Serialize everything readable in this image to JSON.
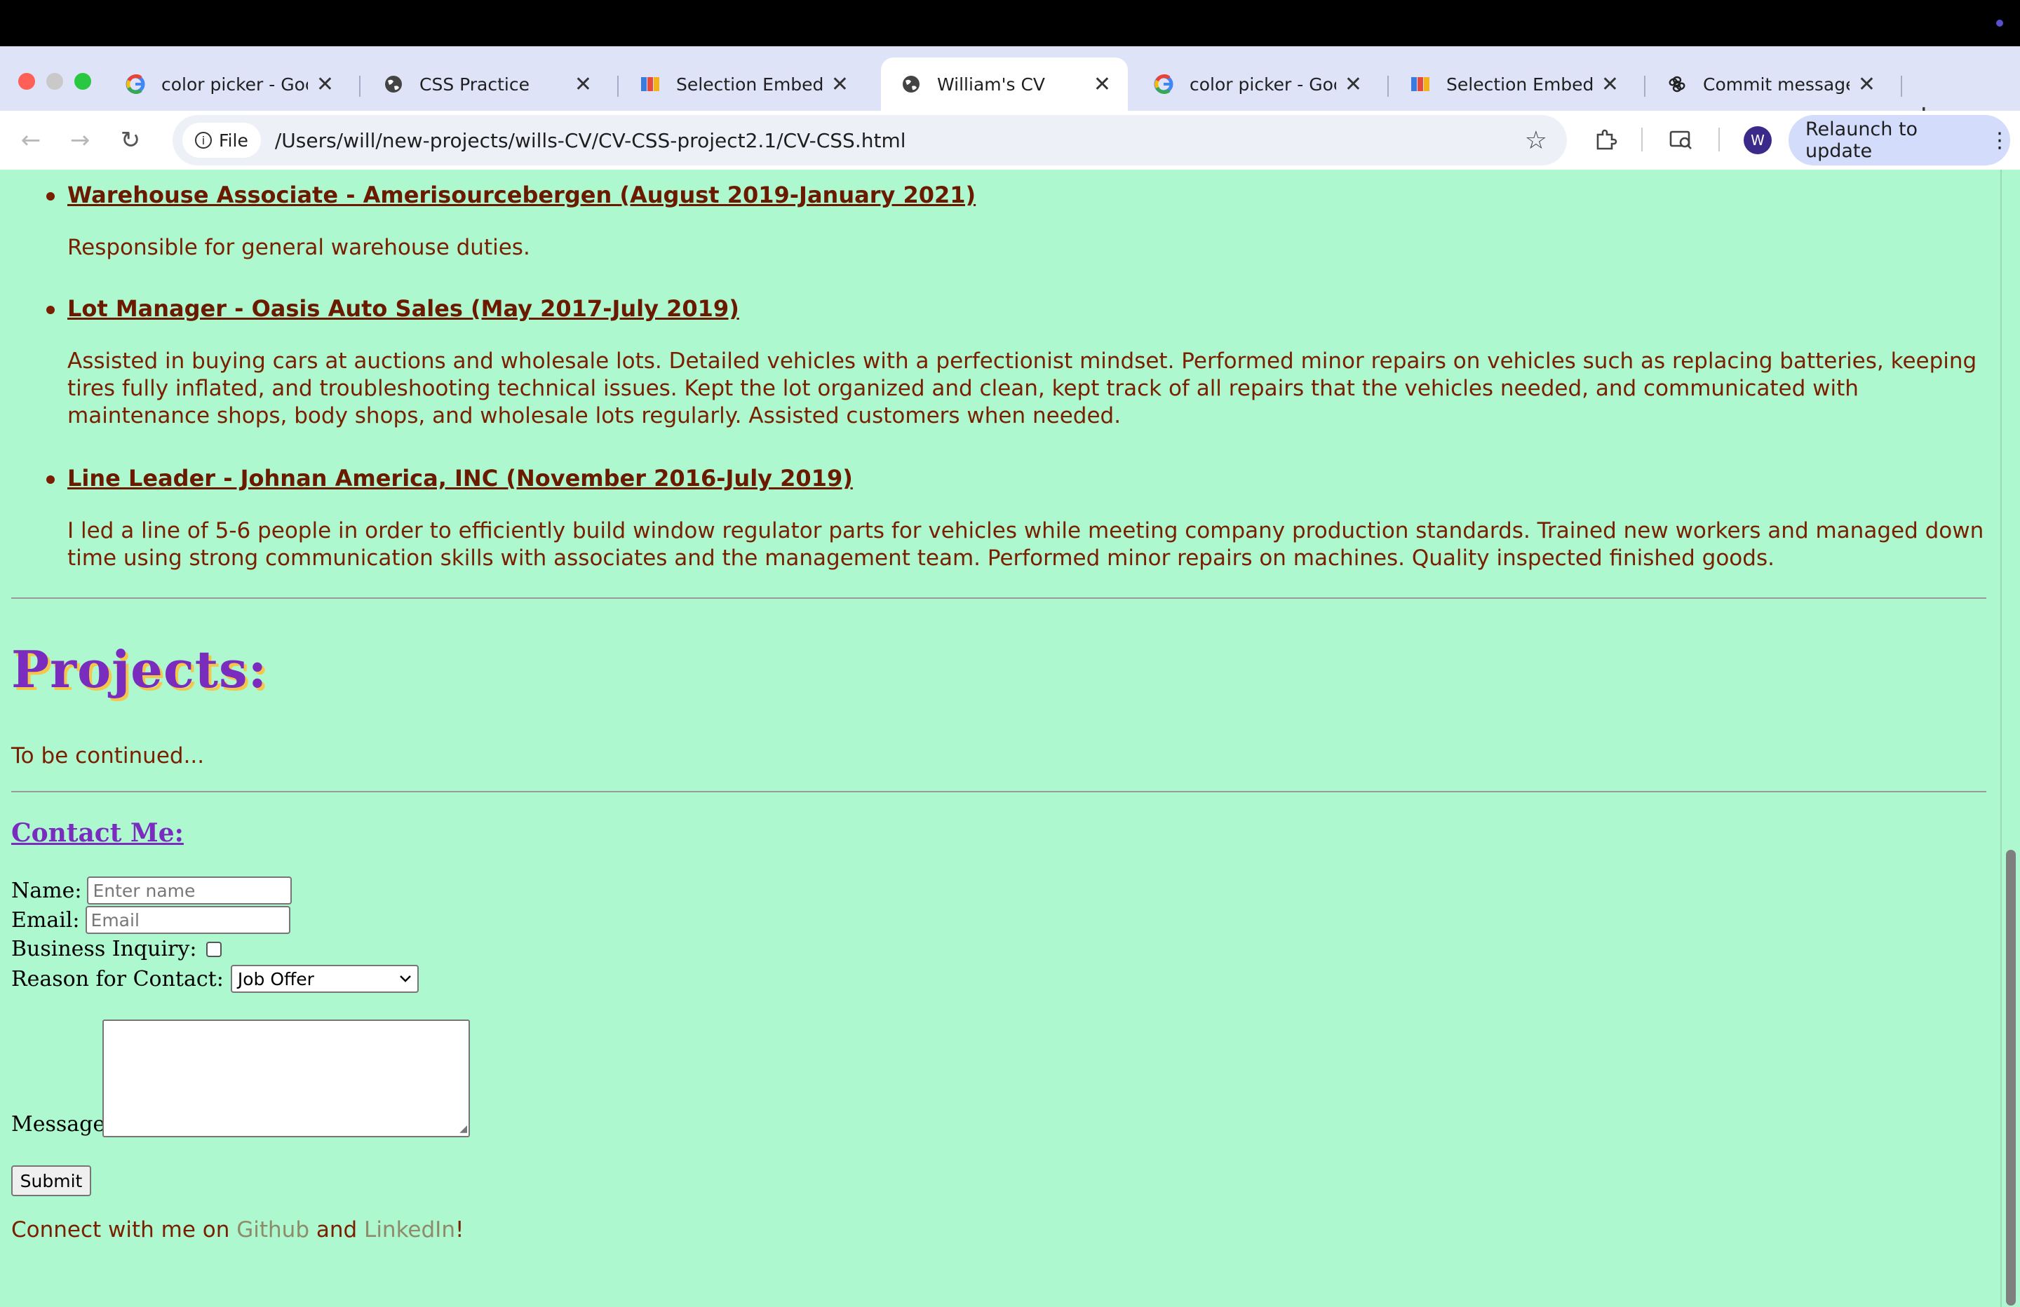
{
  "browser": {
    "tabs": [
      {
        "title": "color picker - Googl",
        "icon": "google-icon",
        "active": false
      },
      {
        "title": "CSS Practice",
        "icon": "globe-icon",
        "active": false
      },
      {
        "title": "Selection Embed Co",
        "icon": "puzzle-icon",
        "active": false
      },
      {
        "title": "William's CV",
        "icon": "globe-icon",
        "active": true
      },
      {
        "title": "color picker - Googl",
        "icon": "google-icon",
        "active": false
      },
      {
        "title": "Selection Embed Co",
        "icon": "puzzle-icon",
        "active": false
      },
      {
        "title": "Commit message su",
        "icon": "openai-icon",
        "active": false
      }
    ],
    "site_chip": "File",
    "url": "/Users/will/new-projects/wills-CV/CV-CSS-project2.1/CV-CSS.html",
    "avatar_letter": "W",
    "relaunch_label": "Relaunch to update"
  },
  "page": {
    "jobs": [
      {
        "title": "Warehouse Associate - Amerisourcebergen (August 2019-January 2021)",
        "description": "Responsible for general warehouse duties."
      },
      {
        "title": "Lot Manager - Oasis Auto Sales (May 2017-July 2019)",
        "description": "Assisted in buying cars at auctions and wholesale lots. Detailed vehicles with a perfectionist mindset. Performed minor repairs on vehicles such as replacing batteries, keeping tires fully inflated, and troubleshooting technical issues. Kept the lot organized and clean, kept track of all repairs that the vehicles needed, and communicated with maintenance shops, body shops, and wholesale lots regularly. Assisted customers when needed."
      },
      {
        "title": "Line Leader - Johnan America, INC (November 2016-July 2019)",
        "description": "I led a line of 5-6 people in order to efficiently build window regulator parts for vehicles while meeting company production standards. Trained new workers and managed down time using strong communication skills with associates and the management team. Performed minor repairs on machines. Quality inspected finished goods."
      }
    ],
    "projects_title": "Projects:",
    "projects_text": "To be continued...",
    "contact": {
      "title": "Contact Me:",
      "name_label": "Name:",
      "name_placeholder": "Enter name",
      "email_label": "Email:",
      "email_placeholder": "Email",
      "business_label": "Business Inquiry:",
      "business_checked": false,
      "reason_label": "Reason for Contact:",
      "reason_selected": "Job Offer",
      "message_label": "Message:",
      "submit_label": "Submit"
    },
    "connect": {
      "prefix": "Connect with me on ",
      "github": "Github",
      "middle": " and ",
      "linkedin": "LinkedIn",
      "suffix": "!"
    }
  },
  "colors": {
    "page_background": "#adf8cf",
    "body_text": "#7a1f00",
    "heading_purple": "#7a2cbf",
    "heading_shadow": "#f5c64a",
    "link": "#8f8b6a"
  }
}
